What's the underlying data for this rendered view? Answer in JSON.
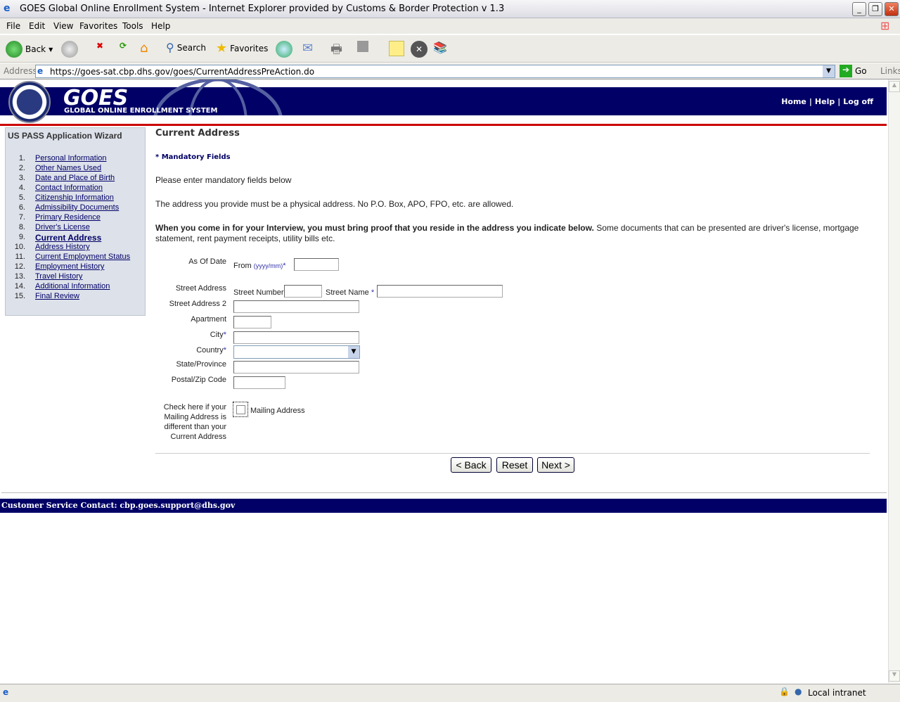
{
  "window": {
    "title": "GOES Global Online Enrollment System - Internet Explorer provided by Customs & Border Protection v 1.3"
  },
  "menu": [
    "File",
    "Edit",
    "View",
    "Favorites",
    "Tools",
    "Help"
  ],
  "toolbar": {
    "back": "Back",
    "search": "Search",
    "favorites": "Favorites"
  },
  "address": {
    "label": "Address",
    "url": "https://goes-sat.cbp.dhs.gov/goes/CurrentAddressPreAction.do",
    "go": "Go",
    "links": "Links"
  },
  "header": {
    "logo": "GOES",
    "subtitle": "GLOBAL ONLINE ENROLLMENT SYSTEM",
    "nav": {
      "home": "Home",
      "sep": "|",
      "help": "Help",
      "logoff": "Log off"
    }
  },
  "sidebar": {
    "title": "US PASS Application Wizard",
    "items": [
      {
        "n": "1.",
        "label": "Personal Information"
      },
      {
        "n": "2.",
        "label": "Other Names Used"
      },
      {
        "n": "3.",
        "label": "Date and Place of Birth"
      },
      {
        "n": "4.",
        "label": "Contact Information"
      },
      {
        "n": "5.",
        "label": "Citizenship Information"
      },
      {
        "n": "6.",
        "label": "Admissibility Documents"
      },
      {
        "n": "7.",
        "label": "Primary Residence"
      },
      {
        "n": "8.",
        "label": "Driver's License"
      },
      {
        "n": "9.",
        "label": "Current Address"
      },
      {
        "n": "10.",
        "label": "Address History"
      },
      {
        "n": "11.",
        "label": "Current Employment Status"
      },
      {
        "n": "12.",
        "label": "Employment History"
      },
      {
        "n": "13.",
        "label": "Travel History"
      },
      {
        "n": "14.",
        "label": "Additional Information"
      },
      {
        "n": "15.",
        "label": "Final Review"
      }
    ]
  },
  "main": {
    "title": "Current Address",
    "mandatory": "* Mandatory Fields",
    "intro": "Please enter mandatory fields below",
    "physical": "The address you provide must be a physical address. No P.O. Box, APO, FPO, etc. are allowed.",
    "proof_bold": "When you come in for your Interview, you must bring proof that you reside in the address you indicate below.",
    "proof_rest": " Some documents that can be presented are driver's license, mortgage statement, rent payment receipts, utility bills etc."
  },
  "form": {
    "as_of_date": "As Of Date",
    "from": "From",
    "from_hint": "(yyyy/mm)",
    "star": "*",
    "street_address": "Street Address",
    "street_number": "Street Number",
    "street_name": "Street Name",
    "street_address2": "Street Address 2",
    "apartment": "Apartment",
    "city": "City",
    "country": "Country",
    "state": "State/Province",
    "postal": "Postal/Zip Code",
    "mailing_help": "Check here if your Mailing Address is different than your Current Address",
    "mailing_label": "Mailing Address",
    "mailing_checked": false
  },
  "buttons": {
    "back": "< Back",
    "reset": "Reset",
    "next": "Next >"
  },
  "footer": {
    "contact": "Customer Service Contact: cbp.goes.support@dhs.gov"
  },
  "status": {
    "zone": "Local intranet"
  }
}
